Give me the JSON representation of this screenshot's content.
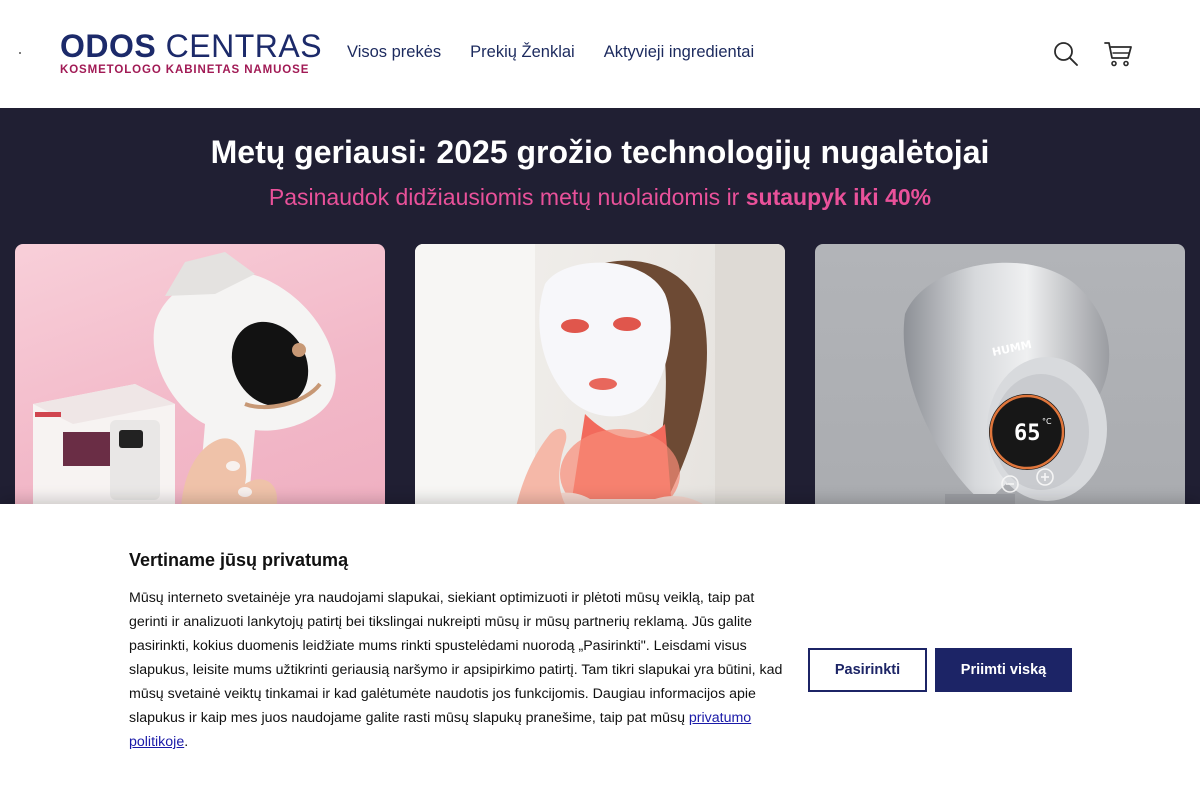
{
  "header": {
    "logo": {
      "word1": "ODOS",
      "word2": "CENTRAS",
      "tagline": "KOSMETOLOGO KABINETAS NAMUOSE"
    },
    "nav": [
      {
        "label": "Visos prekės"
      },
      {
        "label": "Prekių Ženklai"
      },
      {
        "label": "Aktyvieji ingredientai"
      }
    ],
    "icons": {
      "search": "search-icon",
      "cart": "cart-icon"
    }
  },
  "hero": {
    "title": "Metų geriausi: 2025 grožio technologijų nugalėtojai",
    "subtitle_prefix": "Pasinaudok didžiausiomis metų nuolaidomis ir ",
    "subtitle_highlight": "sutaupyk iki 40%",
    "products": [
      {
        "image": "ipl-hair-removal-device-photo"
      },
      {
        "image": "led-light-therapy-mask-photo"
      },
      {
        "image": "silver-device-with-digital-display-photo",
        "display_value": "65",
        "display_unit": "°C"
      }
    ]
  },
  "cookie": {
    "title": "Vertiname jūsų privatumą",
    "text": "Mūsų interneto svetainėje yra naudojami slapukai, siekiant optimizuoti ir plėtoti mūsų veiklą, taip pat gerinti ir analizuoti lankytojų patirtį bei tikslingai nukreipti mūsų ir mūsų partnerių reklamą. Jūs galite pasirinkti, kokius duomenis leidžiate mums rinkti spustelėdami nuorodą „Pasirinkti\". Leisdami visus slapukus, leisite mums užtikrinti geriausią naršymo ir apsipirkimo patirtį. Tam tikri slapukai yra būtini, kad mūsų svetainė veiktų tinkamai ir kad galėtumėte naudotis jos funkcijomis. Daugiau informacijos apie slapukus ir kaip mes juos naudojame galite rasti mūsų slapukų pranešime, taip pat mūsų ",
    "link_label": "privatumo politikoje",
    "text_end": ".",
    "buttons": {
      "choose": "Pasirinkti",
      "accept": "Priimti viską"
    }
  },
  "colors": {
    "brand_navy": "#1c2466",
    "brand_magenta": "#a11a55",
    "hero_bg": "#201f33",
    "accent_pink": "#e9519a"
  }
}
